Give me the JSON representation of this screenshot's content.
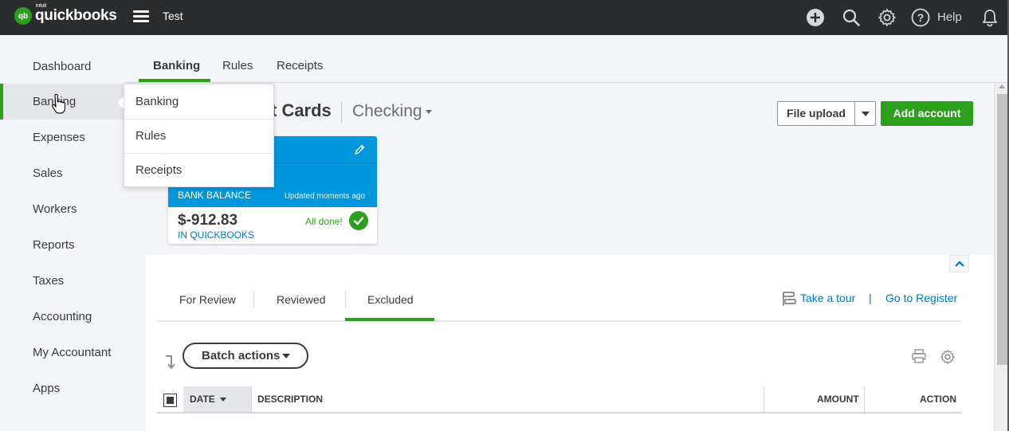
{
  "topbar": {
    "logo_badge": "qb",
    "logo_intuit": "intuit",
    "logo_text": "quickbooks",
    "company_name": "Test",
    "help_label": "Help",
    "icons": [
      "plus-circle-icon",
      "search-icon",
      "gear-icon",
      "help-circle-icon",
      "bell-icon"
    ]
  },
  "leftnav": {
    "items": [
      {
        "label": "Dashboard"
      },
      {
        "label": "Banking"
      },
      {
        "label": "Expenses"
      },
      {
        "label": "Sales"
      },
      {
        "label": "Workers"
      },
      {
        "label": "Reports"
      },
      {
        "label": "Taxes"
      },
      {
        "label": "Accounting"
      },
      {
        "label": "My Accountant"
      },
      {
        "label": "Apps"
      }
    ],
    "active": "Banking"
  },
  "tabs": [
    {
      "label": "Banking"
    },
    {
      "label": "Rules"
    },
    {
      "label": "Receipts"
    }
  ],
  "dropdown": {
    "items": [
      {
        "label": "Banking"
      },
      {
        "label": "Rules"
      },
      {
        "label": "Receipts"
      }
    ]
  },
  "header": {
    "title_visible": "t Cards",
    "account": "Checking",
    "file_upload_label": "File upload",
    "add_account_label": "Add account"
  },
  "card": {
    "bank_balance_label": "BANK BALANCE",
    "updated_label": "Updated moments ago",
    "amount": "$-912.83",
    "in_qb_label": "IN QUICKBOOKS",
    "status": "All done!"
  },
  "subtabs": [
    {
      "label": "For Review"
    },
    {
      "label": "Reviewed"
    },
    {
      "label": "Excluded"
    }
  ],
  "links": {
    "tour": "Take a tour",
    "separator": "|",
    "register": "Go to Register"
  },
  "batch_actions_label": "Batch actions",
  "table": {
    "columns": [
      {
        "label": "DATE"
      },
      {
        "label": "DESCRIPTION"
      },
      {
        "label": "AMOUNT"
      },
      {
        "label": "ACTION"
      }
    ]
  },
  "colors": {
    "brand_green": "#2ca01c",
    "topbar": "#2b2c2e",
    "card_blue": "#0097dd",
    "link_blue": "#0077c5"
  }
}
